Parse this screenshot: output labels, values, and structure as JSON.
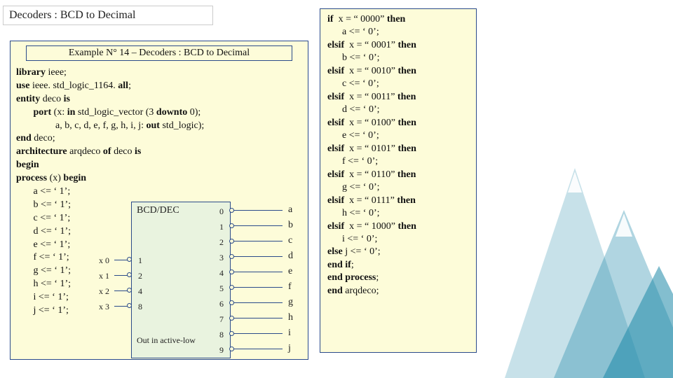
{
  "title": "Decoders : BCD to Decimal",
  "example_header": "Example N° 14 – Decoders : BCD to Decimal",
  "code_left": {
    "l1a": "library",
    "l1b": " ieee;",
    "l2a": "use",
    "l2b": " ieee. std_logic_1164. ",
    "l2c": "all",
    "l2d": ";",
    "l3a": "entity",
    "l3b": " deco ",
    "l3c": "is",
    "l4a": "       port",
    "l4b": " (x: ",
    "l4c": "in",
    "l4d": " std_logic_vector (3 ",
    "l4e": "downto",
    "l4f": " 0);",
    "l5a": "                a, b, c, d, e, f, g, h, i, j: ",
    "l5b": "out",
    "l5c": " std_logic);",
    "l6a": "end",
    "l6b": " deco;",
    "l7a": "architecture",
    "l7b": " arqdeco ",
    "l7c": "of",
    "l7d": " deco ",
    "l7e": "is",
    "l8a": "begin",
    "l9a": "process",
    "l9b": " (x) ",
    "l9c": "begin",
    "l10": "       a <= ‘ 1’;",
    "l11": "       b <= ‘ 1’;",
    "l12": "       c <= ‘ 1’;",
    "l13": "       d <= ‘ 1’;",
    "l14": "       e <= ‘ 1’;",
    "l15": "       f <= ‘ 1’;",
    "l16": "       g <= ‘ 1’;",
    "l17": "       h <= ‘ 1’;",
    "l18": "       i <= ‘ 1’;",
    "l19": "       j <= ‘ 1’;"
  },
  "code_right": {
    "r1a": "if ",
    "r1b": " x = “ 0000” ",
    "r1c": "then",
    "r2": "      a <= ‘ 0’;",
    "r3a": "elsif",
    "r3b": "  x = “ 0001” ",
    "r3c": "then",
    "r4": "      b <= ‘ 0’;",
    "r5a": "elsif",
    "r5b": "  x = “ 0010” ",
    "r5c": "then",
    "r6": "      c <= ‘ 0’;",
    "r7a": "elsif",
    "r7b": "  x = “ 0011” ",
    "r7c": "then",
    "r8": "      d <= ‘ 0’;",
    "r9a": "elsif",
    "r9b": "  x = “ 0100” ",
    "r9c": "then",
    "r10": "      e <= ‘ 0’;",
    "r11a": "elsif",
    "r11b": "  x = “ 0101” ",
    "r11c": "then",
    "r12": "      f <= ‘ 0’;",
    "r13a": "elsif",
    "r13b": "  x = “ 0110” ",
    "r13c": "then",
    "r14": "      g <= ‘ 0’;",
    "r15a": "elsif",
    "r15b": "  x = “ 0111” ",
    "r15c": "then",
    "r16": "      h <= ‘ 0’;",
    "r17a": "elsif",
    "r17b": "  x = “ 1000” ",
    "r17c": "then",
    "r18": "      i <= ‘ 0’;",
    "r19a": "else",
    "r19b": " j <= ‘ 0’;",
    "r20a": "end if",
    "r20b": ";",
    "r21a": "end process",
    "r21b": ";",
    "r22a": "end",
    "r22b": " arqdeco;"
  },
  "diagram": {
    "title": "BCD/DEC",
    "footnote": "Out in active-low",
    "inputs": {
      "0": {
        "name": "x 0",
        "weight": "1"
      },
      "1": {
        "name": "x 1",
        "weight": "2"
      },
      "2": {
        "name": "x 2",
        "weight": "4"
      },
      "3": {
        "name": "x 3",
        "weight": "8"
      }
    },
    "outputs": {
      "0": {
        "num": "0",
        "label": "a"
      },
      "1": {
        "num": "1",
        "label": "b"
      },
      "2": {
        "num": "2",
        "label": "c"
      },
      "3": {
        "num": "3",
        "label": "d"
      },
      "4": {
        "num": "4",
        "label": "e"
      },
      "5": {
        "num": "5",
        "label": "f"
      },
      "6": {
        "num": "6",
        "label": "g"
      },
      "7": {
        "num": "7",
        "label": "h"
      },
      "8": {
        "num": "8",
        "label": "i"
      },
      "9": {
        "num": "9",
        "label": "j"
      }
    }
  }
}
